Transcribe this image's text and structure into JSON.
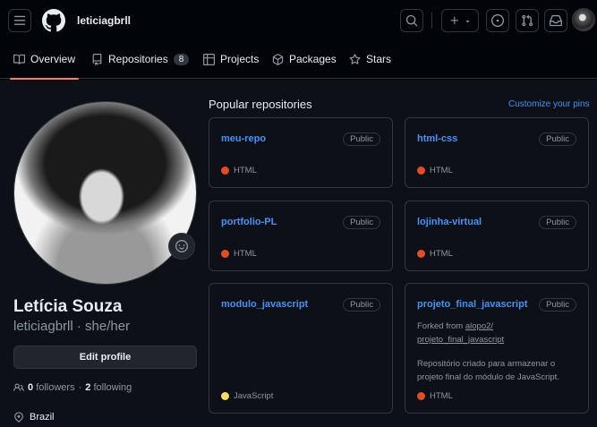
{
  "header": {
    "username": "leticiagbrll"
  },
  "tabs": [
    {
      "label": "Overview",
      "icon": "book-icon"
    },
    {
      "label": "Repositories",
      "icon": "repo-icon",
      "count": "8"
    },
    {
      "label": "Projects",
      "icon": "table-icon"
    },
    {
      "label": "Packages",
      "icon": "package-icon"
    },
    {
      "label": "Stars",
      "icon": "star-icon"
    }
  ],
  "profile": {
    "full_name": "Letícia Souza",
    "login_line": "leticiagbrll · she/her",
    "edit_label": "Edit profile",
    "followers_count": "0",
    "followers_label": "followers",
    "sep": "·",
    "following_count": "2",
    "following_label": "following",
    "location": "Brazil"
  },
  "popular": {
    "title": "Popular repositories",
    "customize": "Customize your pins",
    "repos": [
      {
        "name": "meu-repo",
        "badge": "Public",
        "language": "HTML",
        "lang_color": "#e34c26"
      },
      {
        "name": "html-css",
        "badge": "Public",
        "language": "HTML",
        "lang_color": "#e34c26"
      },
      {
        "name": "portfolio-PL",
        "badge": "Public",
        "language": "HTML",
        "lang_color": "#e34c26"
      },
      {
        "name": "lojinha-virtual",
        "badge": "Public",
        "language": "HTML",
        "lang_color": "#e34c26"
      },
      {
        "name": "modulo_javascript",
        "badge": "Public",
        "language": "JavaScript",
        "lang_color": "#f1e05a"
      },
      {
        "name": "projeto_final_javascript",
        "badge": "Public",
        "language": "HTML",
        "lang_color": "#e34c26",
        "forked_prefix": "Forked from",
        "forked_from_1": "alopo2/",
        "forked_from_2": "projeto_final_javascript",
        "description": "Repositório criado para armazenar o projeto final do módulo de JavaScript."
      }
    ]
  },
  "colors": {
    "accent": "#4493f8",
    "tab_underline": "#f78166",
    "bg": "#0d1117",
    "border": "#30363d"
  }
}
